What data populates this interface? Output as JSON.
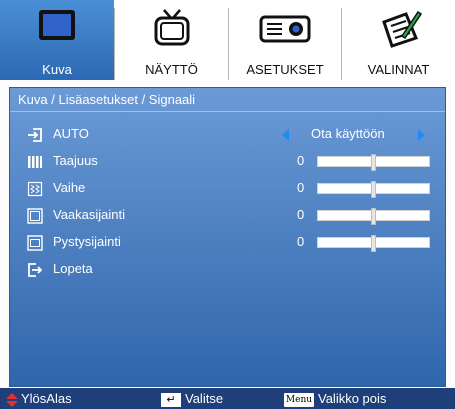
{
  "tabs": [
    {
      "label": "Kuva",
      "icon": "monitor-icon",
      "active": true
    },
    {
      "label": "NÄYTTÖ",
      "icon": "tv-icon",
      "active": false
    },
    {
      "label": "ASETUKSET",
      "icon": "projector-icon",
      "active": false
    },
    {
      "label": "VALINNAT",
      "icon": "options-icon",
      "active": false
    }
  ],
  "breadcrumb": "Kuva / Lisäasetukset / Signaali",
  "items": [
    {
      "label": "AUTO",
      "icon": "input-icon",
      "value": "Ota käyttöön"
    },
    {
      "label": "Taajuus",
      "icon": "frequency-icon",
      "value": "0",
      "level": 0.5
    },
    {
      "label": "Vaihe",
      "icon": "phase-icon",
      "value": "0",
      "level": 0.5
    },
    {
      "label": "Vaakasijainti",
      "icon": "horizontal-position-icon",
      "value": "0",
      "level": 0.5
    },
    {
      "label": "Pystysijainti",
      "icon": "vertical-position-icon",
      "value": "0",
      "level": 0.5
    },
    {
      "label": "Lopeta",
      "icon": "exit-icon"
    }
  ],
  "footer": {
    "updown": "YlösAlas",
    "select": "Valitse",
    "menu_key": "Menu",
    "exit": "Valikko pois"
  },
  "colors": {
    "accent": "#2f66ab",
    "active_tab": "#3c7cc7",
    "arrow": "#1e8cf0",
    "footer": "#1f3f7a",
    "updown_arrow": "#e23030"
  }
}
